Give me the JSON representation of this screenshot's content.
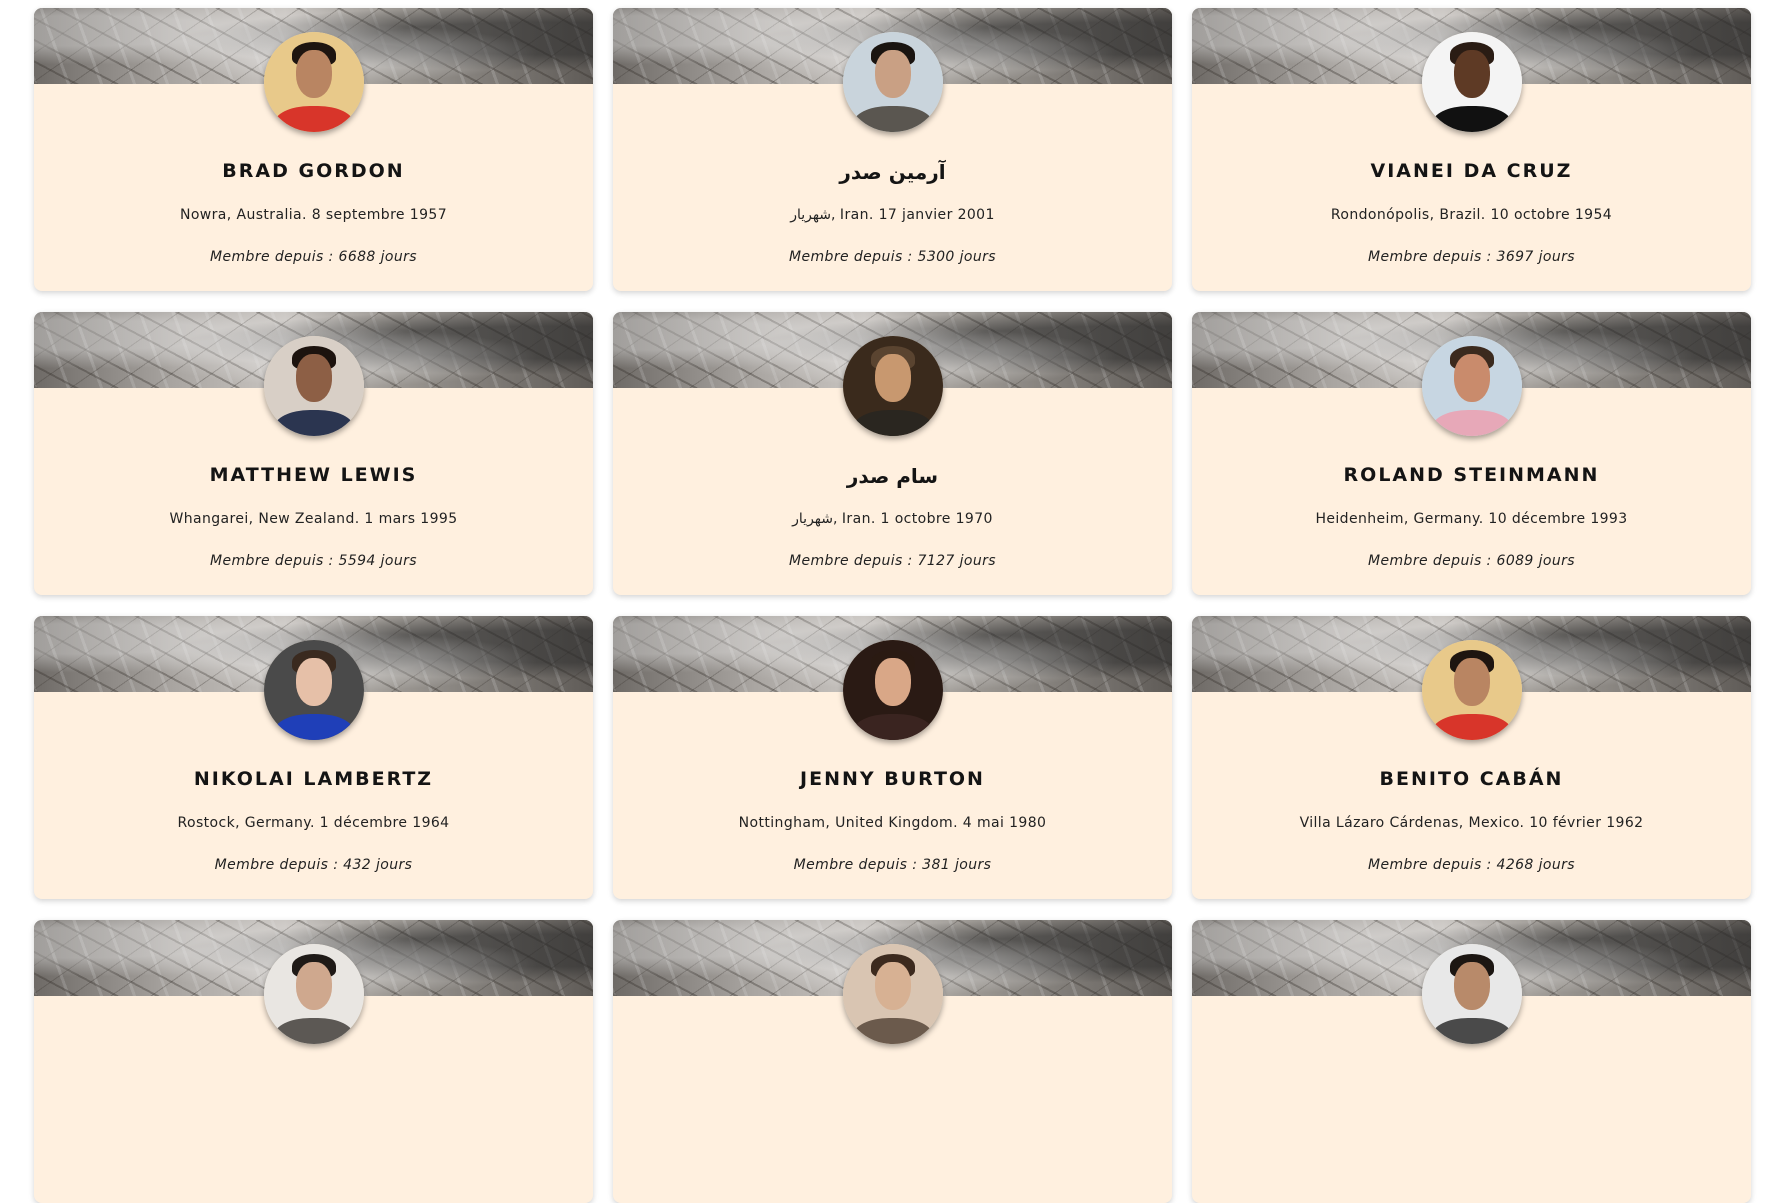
{
  "member_label": "Membre depuis : ",
  "days_suffix": " jours",
  "profiles": [
    {
      "name": "Brad Gordon",
      "location": "Nowra, Australia. 8 septembre 1957",
      "member_since": "Membre depuis : 6688 jours",
      "avatar_icon": "person-portrait-icon",
      "avatar_colors": {
        "bg": "#e8c98a",
        "hair": "#1e1510",
        "face": "#b98562",
        "shirt": "#d8352a"
      }
    },
    {
      "name": "آرمین صدر",
      "location": "شهریار, Iran. 17 janvier 2001",
      "member_since": "Membre depuis : 5300 jours",
      "avatar_icon": "person-portrait-icon",
      "avatar_colors": {
        "bg": "#c9d4dc",
        "hair": "#1a1410",
        "face": "#c9a084",
        "shirt": "#5a5650"
      }
    },
    {
      "name": "Vianei da Cruz",
      "location": "Rondonópolis, Brazil. 10 octobre 1954",
      "member_since": "Membre depuis : 3697 jours",
      "avatar_icon": "person-portrait-icon",
      "avatar_colors": {
        "bg": "#f4f4f4",
        "hair": "#2a1c14",
        "face": "#5e3a25",
        "shirt": "#111111"
      }
    },
    {
      "name": "Matthew Lewis",
      "location": "Whangarei, New Zealand. 1 mars 1995",
      "member_since": "Membre depuis : 5594 jours",
      "avatar_icon": "person-portrait-icon",
      "avatar_colors": {
        "bg": "#d8cfc6",
        "hair": "#1c130e",
        "face": "#8d5f45",
        "shirt": "#2b3550"
      }
    },
    {
      "name": "سام صدر",
      "location": "شهریار, Iran. 1 octobre 1970",
      "member_since": "Membre depuis : 7127 jours",
      "avatar_icon": "person-portrait-icon",
      "avatar_colors": {
        "bg": "#3a2a1c",
        "hair": "#5a4430",
        "face": "#c8986f",
        "shirt": "#2a2620"
      }
    },
    {
      "name": "Roland Steinmann",
      "location": "Heidenheim, Germany. 10 décembre 1993",
      "member_since": "Membre depuis : 6089 jours",
      "avatar_icon": "person-portrait-icon",
      "avatar_colors": {
        "bg": "#c7d6e2",
        "hair": "#3b2a1e",
        "face": "#c98b6c",
        "shirt": "#e7a8b8"
      }
    },
    {
      "name": "Nikolai Lambertz",
      "location": "Rostock, Germany. 1 décembre 1964",
      "member_since": "Membre depuis : 432 jours",
      "avatar_icon": "person-portrait-icon",
      "avatar_colors": {
        "bg": "#4a4a4a",
        "hair": "#3a2a1f",
        "face": "#e6c0a8",
        "shirt": "#1f3fb8"
      }
    },
    {
      "name": "Jenny Burton",
      "location": "Nottingham, United Kingdom. 4 mai 1980",
      "member_since": "Membre depuis : 381 jours",
      "avatar_icon": "person-portrait-icon",
      "avatar_colors": {
        "bg": "#2a1a14",
        "hair": "#2a1a12",
        "face": "#d9a787",
        "shirt": "#3a2420"
      }
    },
    {
      "name": "Benito Cabán",
      "location": "Villa Lázaro Cárdenas, Mexico. 10 février 1962",
      "member_since": "Membre depuis : 4268 jours",
      "avatar_icon": "person-portrait-icon",
      "avatar_colors": {
        "bg": "#e8c98a",
        "hair": "#1e1510",
        "face": "#b98562",
        "shirt": "#d8352a"
      }
    },
    {
      "name": "",
      "location": "",
      "member_since": "",
      "avatar_icon": "person-portrait-icon",
      "avatar_colors": {
        "bg": "#e9e6e2",
        "hair": "#1f1a17",
        "face": "#cfa88e",
        "shirt": "#5c5854"
      }
    },
    {
      "name": "",
      "location": "",
      "member_since": "",
      "avatar_icon": "person-portrait-icon",
      "avatar_colors": {
        "bg": "#d9c5b2",
        "hair": "#3c2a1e",
        "face": "#d7b193",
        "shirt": "#6b5a4c"
      }
    },
    {
      "name": "",
      "location": "",
      "member_since": "",
      "avatar_icon": "person-portrait-icon",
      "avatar_colors": {
        "bg": "#e8e8e8",
        "hair": "#1c1612",
        "face": "#b88a6a",
        "shirt": "#4a4a4a"
      }
    }
  ]
}
